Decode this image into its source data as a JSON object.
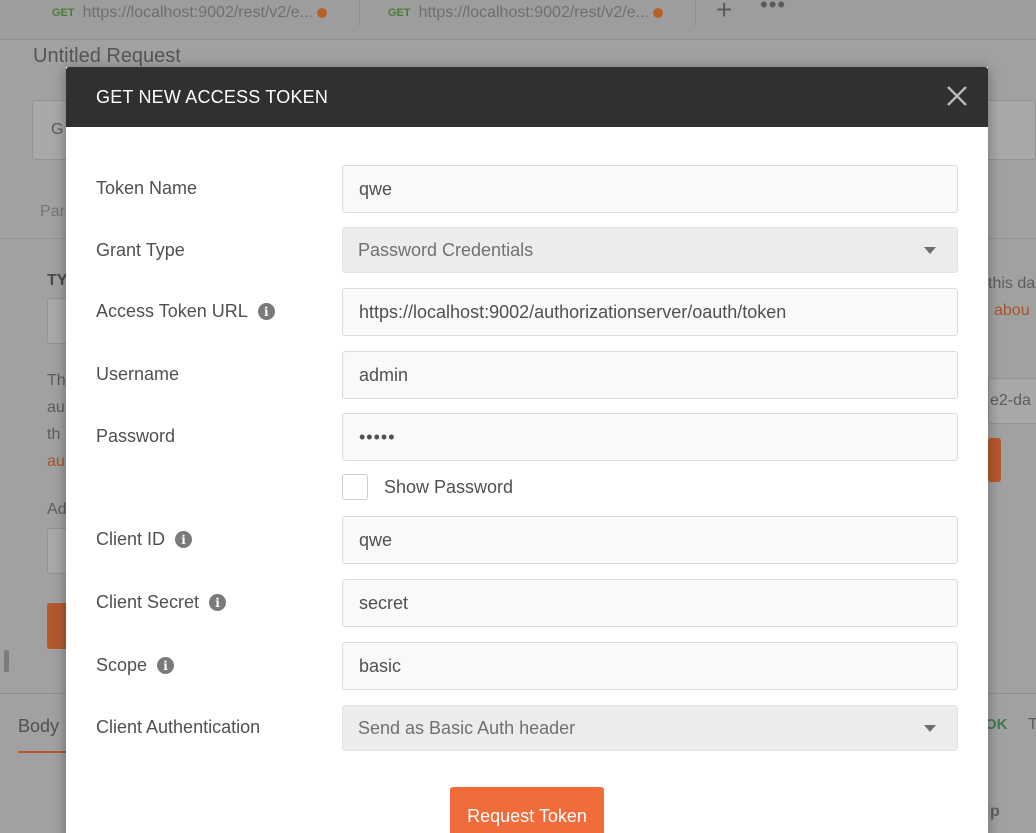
{
  "background": {
    "tabs": [
      {
        "method": "GET",
        "url": "https://localhost:9002/rest/v2/e..."
      },
      {
        "method": "GET",
        "url": "https://localhost:9002/rest/v2/e..."
      }
    ],
    "new_tab_label": "+",
    "more_label": "•••",
    "request_title": "Untitled Request",
    "method_partial": "G",
    "params_partial": "Par",
    "type_partial": "TY",
    "desc_partial_1": "Th",
    "desc_partial_2": "au",
    "desc_partial_3": "th",
    "desc_link_partial": "au",
    "add_partial": "Ad",
    "right_text_1": "this da",
    "right_link_1": "abou",
    "right_text_2": "e2-da",
    "body_tab": "Body",
    "status_ok": "OK",
    "status_t": "T",
    "bottom_right_partial": "p"
  },
  "modal": {
    "title": "GET NEW ACCESS TOKEN",
    "fields": {
      "token_name": {
        "label": "Token Name",
        "value": "qwe"
      },
      "grant_type": {
        "label": "Grant Type",
        "value": "Password Credentials"
      },
      "access_token_url": {
        "label": "Access Token URL",
        "value": "https://localhost:9002/authorizationserver/oauth/token"
      },
      "username": {
        "label": "Username",
        "value": "admin"
      },
      "password": {
        "label": "Password",
        "value": "•••••"
      },
      "show_password": {
        "label": "Show Password",
        "checked": false
      },
      "client_id": {
        "label": "Client ID",
        "value": "qwe"
      },
      "client_secret": {
        "label": "Client Secret",
        "value": "secret"
      },
      "scope": {
        "label": "Scope",
        "value": "basic"
      },
      "client_authentication": {
        "label": "Client Authentication",
        "value": "Send as Basic Auth header"
      }
    },
    "request_button": "Request Token",
    "info_glyph": "i"
  },
  "colors": {
    "header_bg": "#303030",
    "accent": "#f26b3a",
    "text": "#505050",
    "input_bg": "#f9f9f9",
    "select_bg": "#ececec"
  }
}
